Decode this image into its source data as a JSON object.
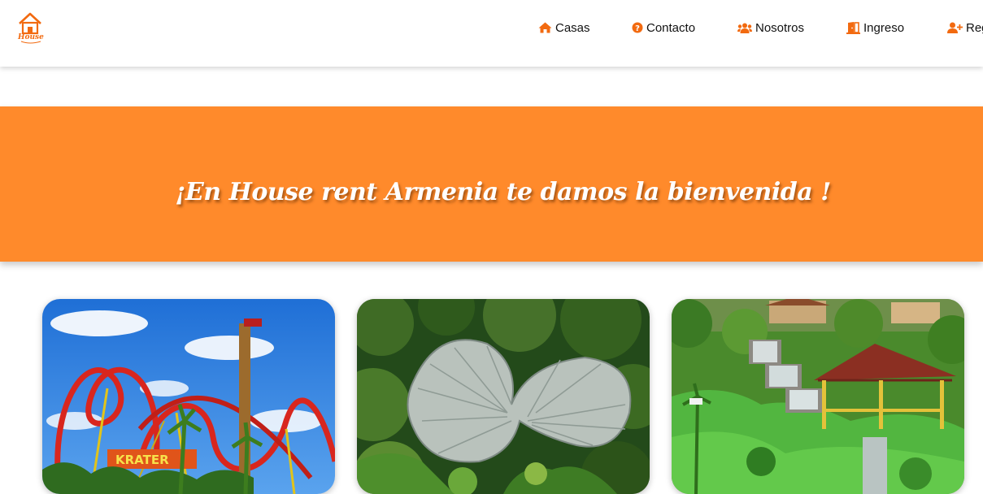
{
  "logo": {
    "text": "House",
    "icon": "house-icon"
  },
  "nav": {
    "items": [
      {
        "label": "Casas",
        "icon": "home-icon"
      },
      {
        "label": "Contacto",
        "icon": "question-circle-icon"
      },
      {
        "label": "Nosotros",
        "icon": "users-icon"
      },
      {
        "label": "Ingreso",
        "icon": "door-open-icon"
      },
      {
        "label": "Reg",
        "icon": "user-plus-icon"
      }
    ]
  },
  "hero": {
    "title": "¡En House rent Armenia te damos la bienvenida !"
  },
  "cards": [
    {
      "image": "roller-coaster-park-photo"
    },
    {
      "image": "butterfly-greenhouse-photo"
    },
    {
      "image": "garden-waterfall-kiosk-photo"
    }
  ],
  "colors": {
    "accent": "#ff8a2b",
    "icon_orange": "#f26a10",
    "nav_text": "#111111"
  }
}
